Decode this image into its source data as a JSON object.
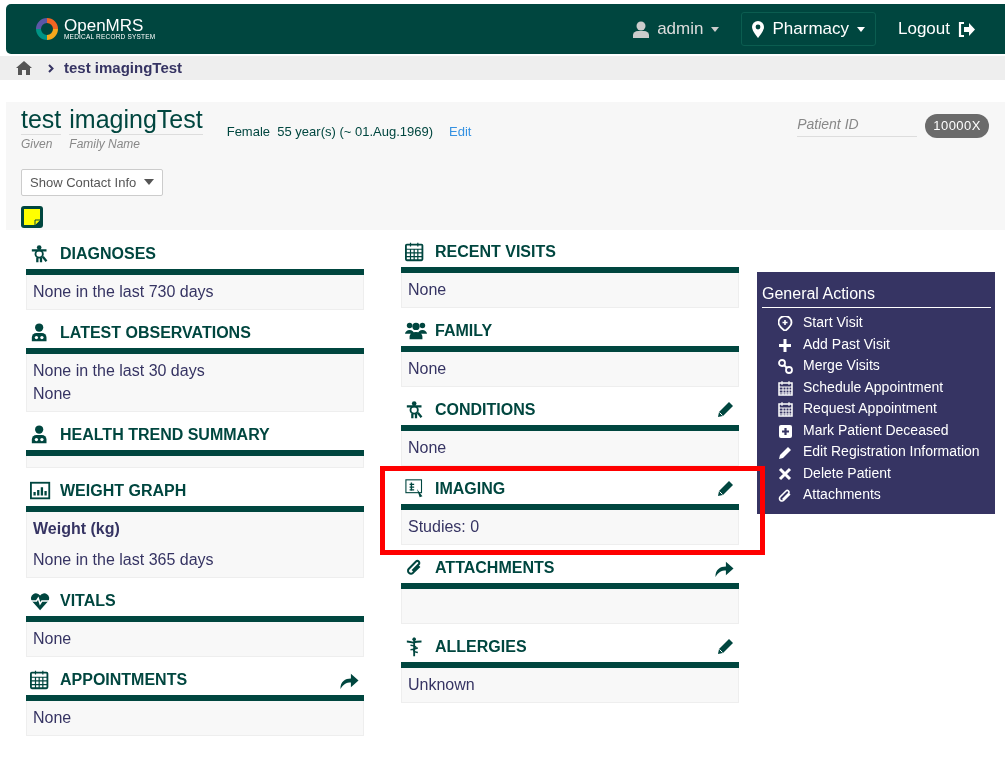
{
  "navbar": {
    "logo_text": "OpenMRS",
    "logo_tagline": "MEDICAL RECORD SYSTEM",
    "user": "admin",
    "location": "Pharmacy",
    "logout": "Logout"
  },
  "breadcrumb": {
    "current": "test imagingTest"
  },
  "patient": {
    "given": "test",
    "family": "imagingTest",
    "given_label": "Given",
    "family_label": "Family Name",
    "demographics": "Female  55 year(s) (~ 01.Aug.1969)",
    "edit_link": "Edit",
    "id_label": "Patient ID",
    "id_value": "10000X",
    "contact_button": "Show Contact Info"
  },
  "columns": [
    [
      {
        "title": "DIAGNOSES",
        "lines": [
          {
            "text": "None in the last 730 days",
            "kind": "plain"
          }
        ],
        "highlighted": false
      },
      {
        "title": "LATEST OBSERVATIONS",
        "lines": [
          {
            "text": "None in the last 30 days",
            "kind": "plain"
          },
          {
            "text": "None",
            "kind": "plain"
          }
        ],
        "highlighted": false
      },
      {
        "title": "HEALTH TREND SUMMARY",
        "highlighted": false
      },
      {
        "title": "WEIGHT GRAPH",
        "lines": [
          {
            "text": "Weight (kg)",
            "kind": "heading"
          },
          {
            "text": "None in the last 365 days",
            "kind": "plain"
          }
        ],
        "highlighted": false
      },
      {
        "title": "VITALS",
        "lines": [
          {
            "text": "None",
            "kind": "plain"
          }
        ],
        "highlighted": false
      },
      {
        "title": "APPOINTMENTS",
        "lines": [
          {
            "text": "None",
            "kind": "plain"
          }
        ],
        "highlighted": false
      }
    ],
    [
      {
        "title": "RECENT VISITS",
        "lines": [
          {
            "text": "None",
            "kind": "plain"
          }
        ],
        "highlighted": false
      },
      {
        "title": "FAMILY",
        "lines": [
          {
            "text": "None",
            "kind": "plain"
          }
        ],
        "highlighted": false
      },
      {
        "title": "CONDITIONS",
        "lines": [
          {
            "text": "None",
            "kind": "plain"
          }
        ],
        "highlighted": false
      },
      {
        "title": "IMAGING",
        "lines": [
          {
            "text": "Studies: 0",
            "kind": "plain"
          }
        ],
        "highlighted": true
      },
      {
        "title": "ATTACHMENTS",
        "highlighted": false
      },
      {
        "title": "ALLERGIES",
        "lines": [
          {
            "text": "Unknown",
            "kind": "plain"
          }
        ],
        "highlighted": false
      }
    ]
  ],
  "general_actions": {
    "title": "General Actions",
    "items": [
      "Start Visit",
      "Add Past Visit",
      "Merge Visits",
      "Schedule Appointment",
      "Request Appointment",
      "Mark Patient Deceased",
      "Edit Registration Information",
      "Delete Patient",
      "Attachments"
    ]
  }
}
